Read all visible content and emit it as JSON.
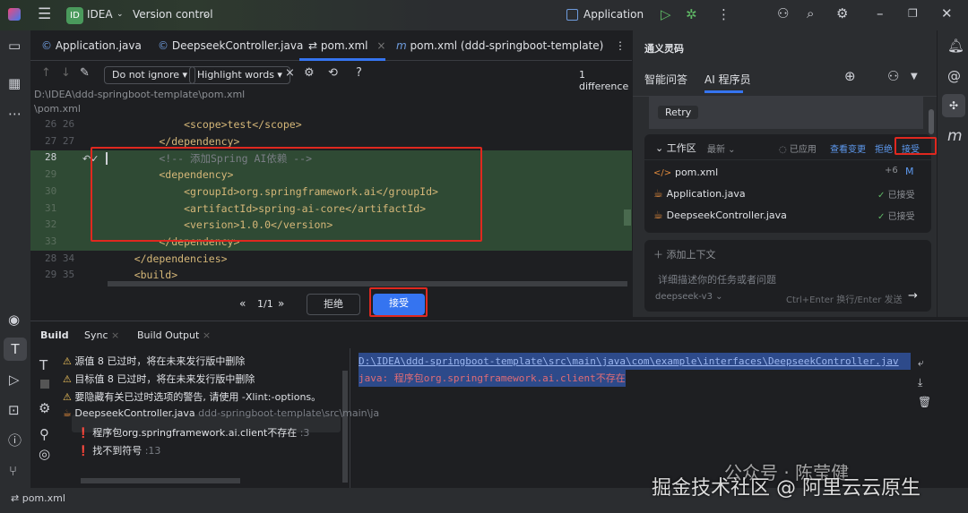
{
  "titlebar": {
    "project": "IDEA",
    "project_badge": "ID",
    "vcs": "Version control",
    "run_config": "Application"
  },
  "editor_tabs": [
    {
      "label": "Application.java",
      "icon": "class-icon"
    },
    {
      "label": "DeepseekController.java",
      "icon": "class-icon"
    },
    {
      "label": "pom.xml",
      "icon": "diff-icon",
      "active": true
    },
    {
      "label": "pom.xml (ddd-springboot-template)",
      "icon": "maven-icon"
    }
  ],
  "diff_toolbar": {
    "ignore": "Do not ignore",
    "highlight": "Highlight words",
    "help": "?",
    "differences": "1 difference"
  },
  "paths": [
    "D:\\IDEA\\ddd-springboot-template\\pom.xml",
    "\\pom.xml"
  ],
  "code_lines": [
    {
      "left": "26",
      "right": "26",
      "text": "        <scope>test</scope>"
    },
    {
      "left": "27",
      "right": "27",
      "text": "    </dependency>"
    },
    {
      "left": "",
      "right": "28",
      "text": "    <!-- 添加Spring AI依赖 -->",
      "comment": true,
      "added": true
    },
    {
      "left": "",
      "right": "29",
      "text": "    <dependency>",
      "added": true
    },
    {
      "left": "",
      "right": "30",
      "text": "        <groupId>org.springframework.ai</groupId>",
      "added": true
    },
    {
      "left": "",
      "right": "31",
      "text": "        <artifactId>spring-ai-core</artifactId>",
      "added": true
    },
    {
      "left": "",
      "right": "32",
      "text": "        <version>1.0.0</version>",
      "added": true
    },
    {
      "left": "",
      "right": "33",
      "text": "    </dependency>",
      "added": true
    },
    {
      "left": "28",
      "right": "34",
      "text": "</dependencies>"
    },
    {
      "left": "29",
      "right": "35",
      "text": "<build>"
    }
  ],
  "diff_nav": {
    "counter": "1/1",
    "reject": "拒绝",
    "accept": "接受"
  },
  "ai_panel": {
    "title": "通义灵码",
    "tabs": [
      "智能问答",
      "AI 程序员"
    ],
    "retry": "Retry",
    "workspace": {
      "label": "工作区",
      "filter": "最新",
      "applied": "已应用",
      "view_changes": "查看变更",
      "reject": "拒绝",
      "accept": "接受"
    },
    "files": [
      {
        "name": "pom.xml",
        "added": "+6",
        "status": "M"
      },
      {
        "name": "Application.java",
        "status": "已接受"
      },
      {
        "name": "DeepseekController.java",
        "status": "已接受"
      }
    ],
    "add_context": "添加上下文",
    "input_placeholder": "详细描述你的任务或者问题",
    "model": "deepseek-v3",
    "hint": "Ctrl+Enter 换行/Enter 发送"
  },
  "build": {
    "tabs": [
      "Build",
      "Sync",
      "Build Output"
    ],
    "tree": [
      {
        "type": "warning",
        "text": "源值 8 已过时，将在未来发行版中删除"
      },
      {
        "type": "warning",
        "text": "目标值 8 已过时，将在未来发行版中删除"
      },
      {
        "type": "warning",
        "text": "要隐藏有关已过时选项的警告, 请使用 -Xlint:-options。"
      },
      {
        "type": "file",
        "text": "DeepseekController.java",
        "path": "ddd-springboot-template\\src\\main\\ja"
      },
      {
        "type": "error",
        "text": "程序包org.springframework.ai.client不存在",
        "line": ":3"
      },
      {
        "type": "error",
        "text": "找不到符号",
        "line": ":13"
      }
    ],
    "output": [
      "D:\\IDEA\\ddd-springboot-template\\src\\main\\java\\com\\example\\interfaces\\DeepseekController.jav",
      "java: 程序包org.springframework.ai.client不存在"
    ]
  },
  "statusbar": {
    "file": "pom.xml"
  },
  "watermark": {
    "line1": "公众号 · 陈莹健",
    "line2": "掘金技术社区 @ 阿里云云原生"
  },
  "colors": {
    "accent": "#3574f0",
    "added_bg": "#2f4a34",
    "highlight_box": "#e0281f"
  }
}
